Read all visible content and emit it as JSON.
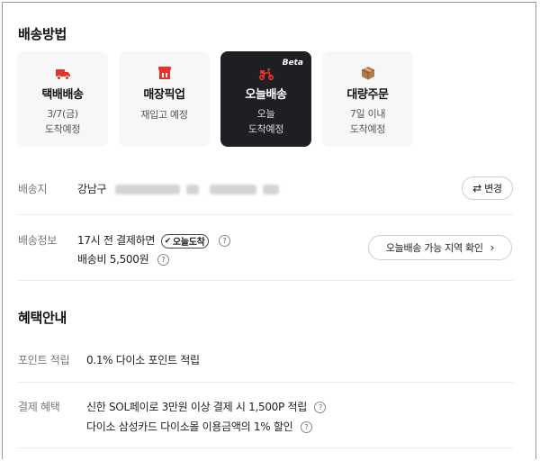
{
  "shipping": {
    "title": "배송방법",
    "options": [
      {
        "label": "택배배송",
        "sub1": "3/7(금)",
        "sub2": "도착예정",
        "icon": "delivery-truck-icon"
      },
      {
        "label": "매장픽업",
        "sub1": "재입고 예정",
        "sub2": "",
        "icon": "store-icon"
      },
      {
        "label": "오늘배송",
        "sub1": "오늘",
        "sub2": "도착예정",
        "icon": "scooter-icon",
        "badge": "Beta",
        "selected": true
      },
      {
        "label": "대량주문",
        "sub1": "7일 이내",
        "sub2": "도착예정",
        "icon": "box-icon"
      }
    ]
  },
  "address": {
    "label": "배송지",
    "value": "강남구",
    "change_button": "변경"
  },
  "delivery_info": {
    "label": "배송정보",
    "line1": "17시 전 결제하면",
    "badge": "오늘도착",
    "fee": "배송비 5,500원",
    "area_button": "오늘배송 가능 지역 확인"
  },
  "benefits": {
    "title": "혜택안내",
    "points_label": "포인트 적립",
    "points_value": "0.1% 다이소 포인트 적립",
    "payment_label": "결제 혜택",
    "payment_line1": "신한 SOL페이로 3만원 이상 결제 시 1,500P 적립",
    "payment_line2": "다이소 삼성카드 다이소몰 이용금액의 1% 할인"
  },
  "colors": {
    "accent": "#e5322d",
    "selected_card": "#1e1f23",
    "card": "#f7f7f8",
    "box": "#b07a4a"
  }
}
